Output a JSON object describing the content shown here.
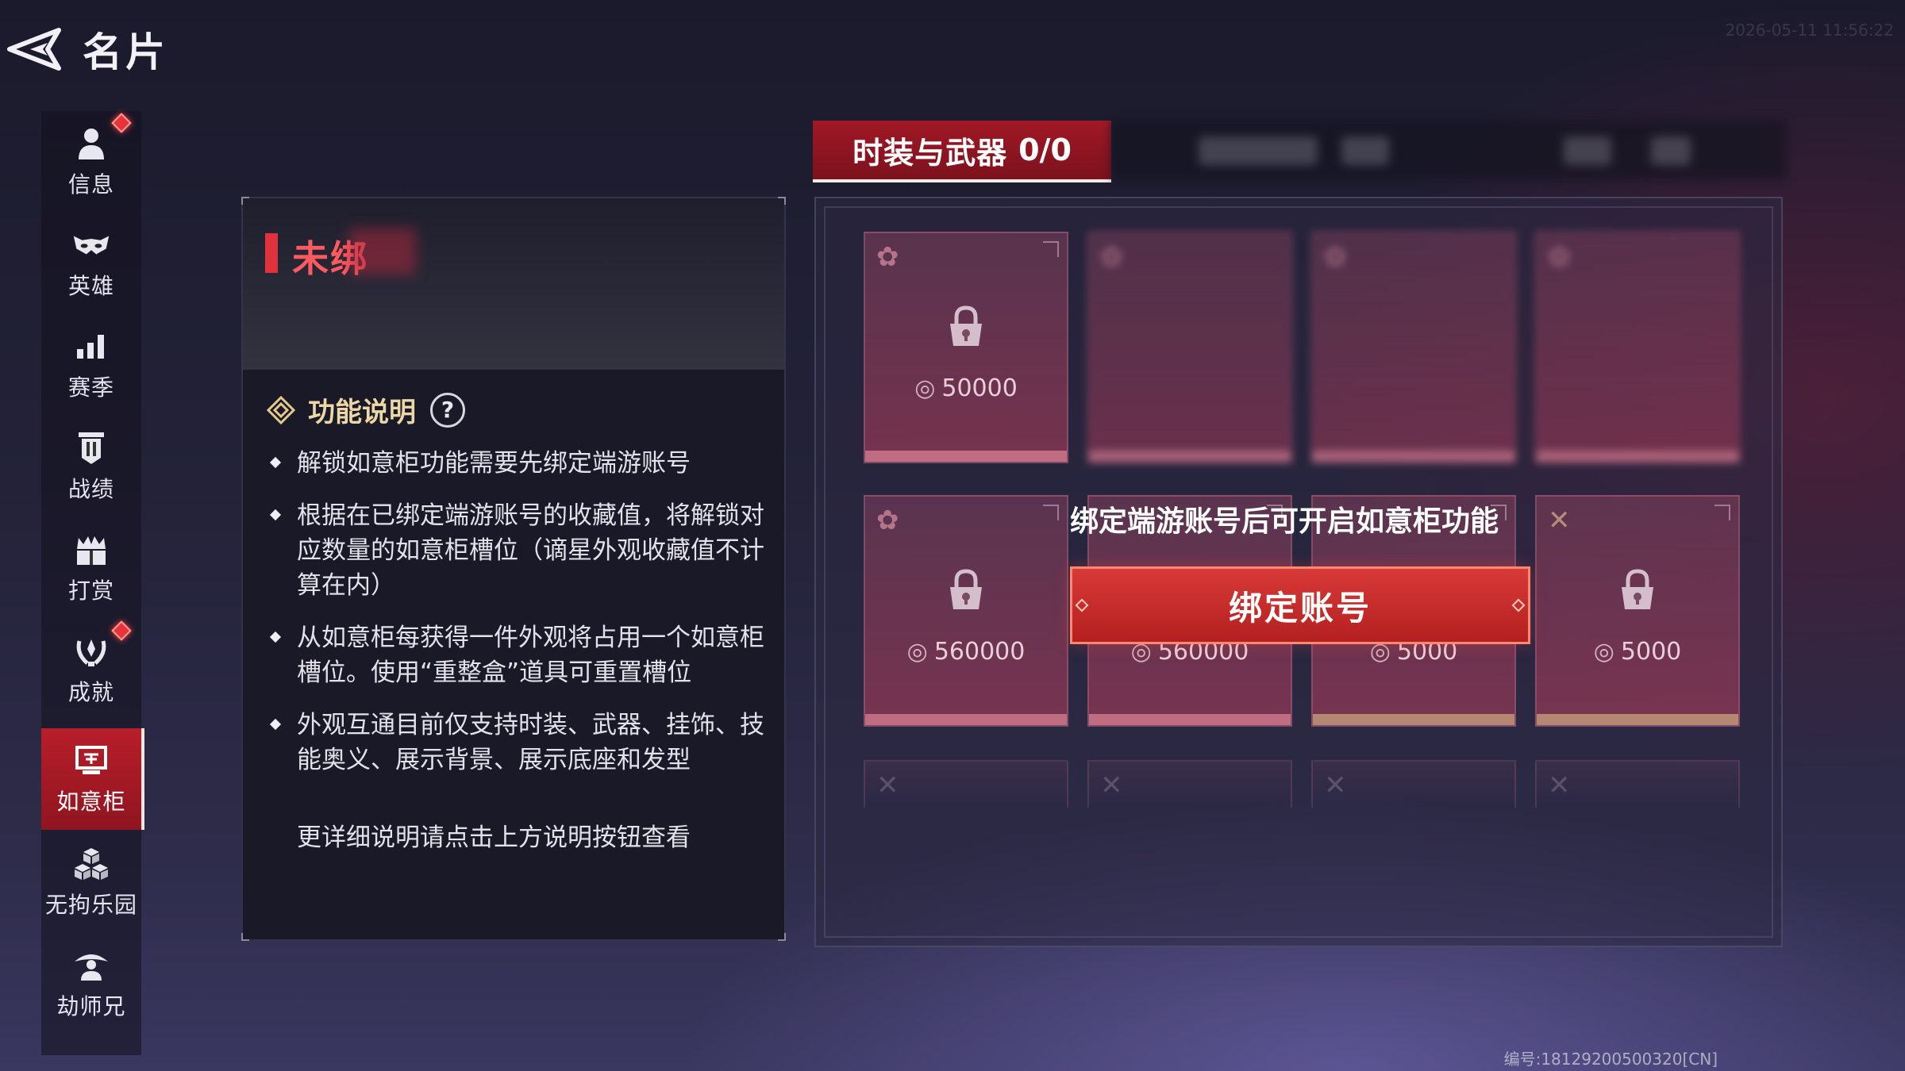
{
  "header": {
    "title": "名片",
    "back_icon": "back-arrow-icon",
    "timestamp": "2026-05-11 11:56:22"
  },
  "sidebar": {
    "items": [
      {
        "label": "信息",
        "icon": "person-icon",
        "badge": true
      },
      {
        "label": "英雄",
        "icon": "hero-mask-icon",
        "badge": false
      },
      {
        "label": "赛季",
        "icon": "bar-chart-icon",
        "badge": false
      },
      {
        "label": "战绩",
        "icon": "banner-icon",
        "badge": false
      },
      {
        "label": "打赏",
        "icon": "gift-icon",
        "badge": false
      },
      {
        "label": "成就",
        "icon": "laurel-icon",
        "badge": true
      },
      {
        "label": "如意柜",
        "icon": "cabinet-icon",
        "badge": false,
        "active": true
      },
      {
        "label": "无拘乐园",
        "icon": "cubes-icon",
        "badge": false
      },
      {
        "label": "劫师兄",
        "icon": "hat-figure-icon",
        "badge": false
      }
    ]
  },
  "info_panel": {
    "status": "未绑",
    "section_title": "功能说明",
    "help_symbol": "?",
    "bullets": [
      "解锁如意柜功能需要先绑定端游账号",
      "根据在已绑定端游账号的收藏值，将解锁对应数量的如意柜槽位（谪星外观收藏值不计算在内）",
      "从如意柜每获得一件外观将占用一个如意柜槽位。使用“重整盒”道具可重置槽位",
      "外观互通目前仅支持时装、武器、挂饰、技能奥义、展示背景、展示底座和发型"
    ],
    "more_note": "更详细说明请点击上方说明按钮查看"
  },
  "cabinet": {
    "tab": {
      "label": "时装与武器",
      "count": "0/0"
    },
    "slots_row1": [
      {
        "cost": "50000"
      }
    ],
    "slots_row2": [
      {
        "cost": "560000"
      },
      {
        "cost": "560000"
      },
      {
        "cost": "5000"
      },
      {
        "cost": "5000"
      }
    ],
    "bind_hint": "绑定端游账号后可开启如意柜功能",
    "bind_button": "绑定账号"
  },
  "footer": {
    "code": "编号:18129200500320[CN]"
  },
  "colors": {
    "accent_red": "#b81e2a",
    "button_red": "#d83a38",
    "gold_text": "#ecd8a6",
    "status_red": "#ff5a60"
  }
}
